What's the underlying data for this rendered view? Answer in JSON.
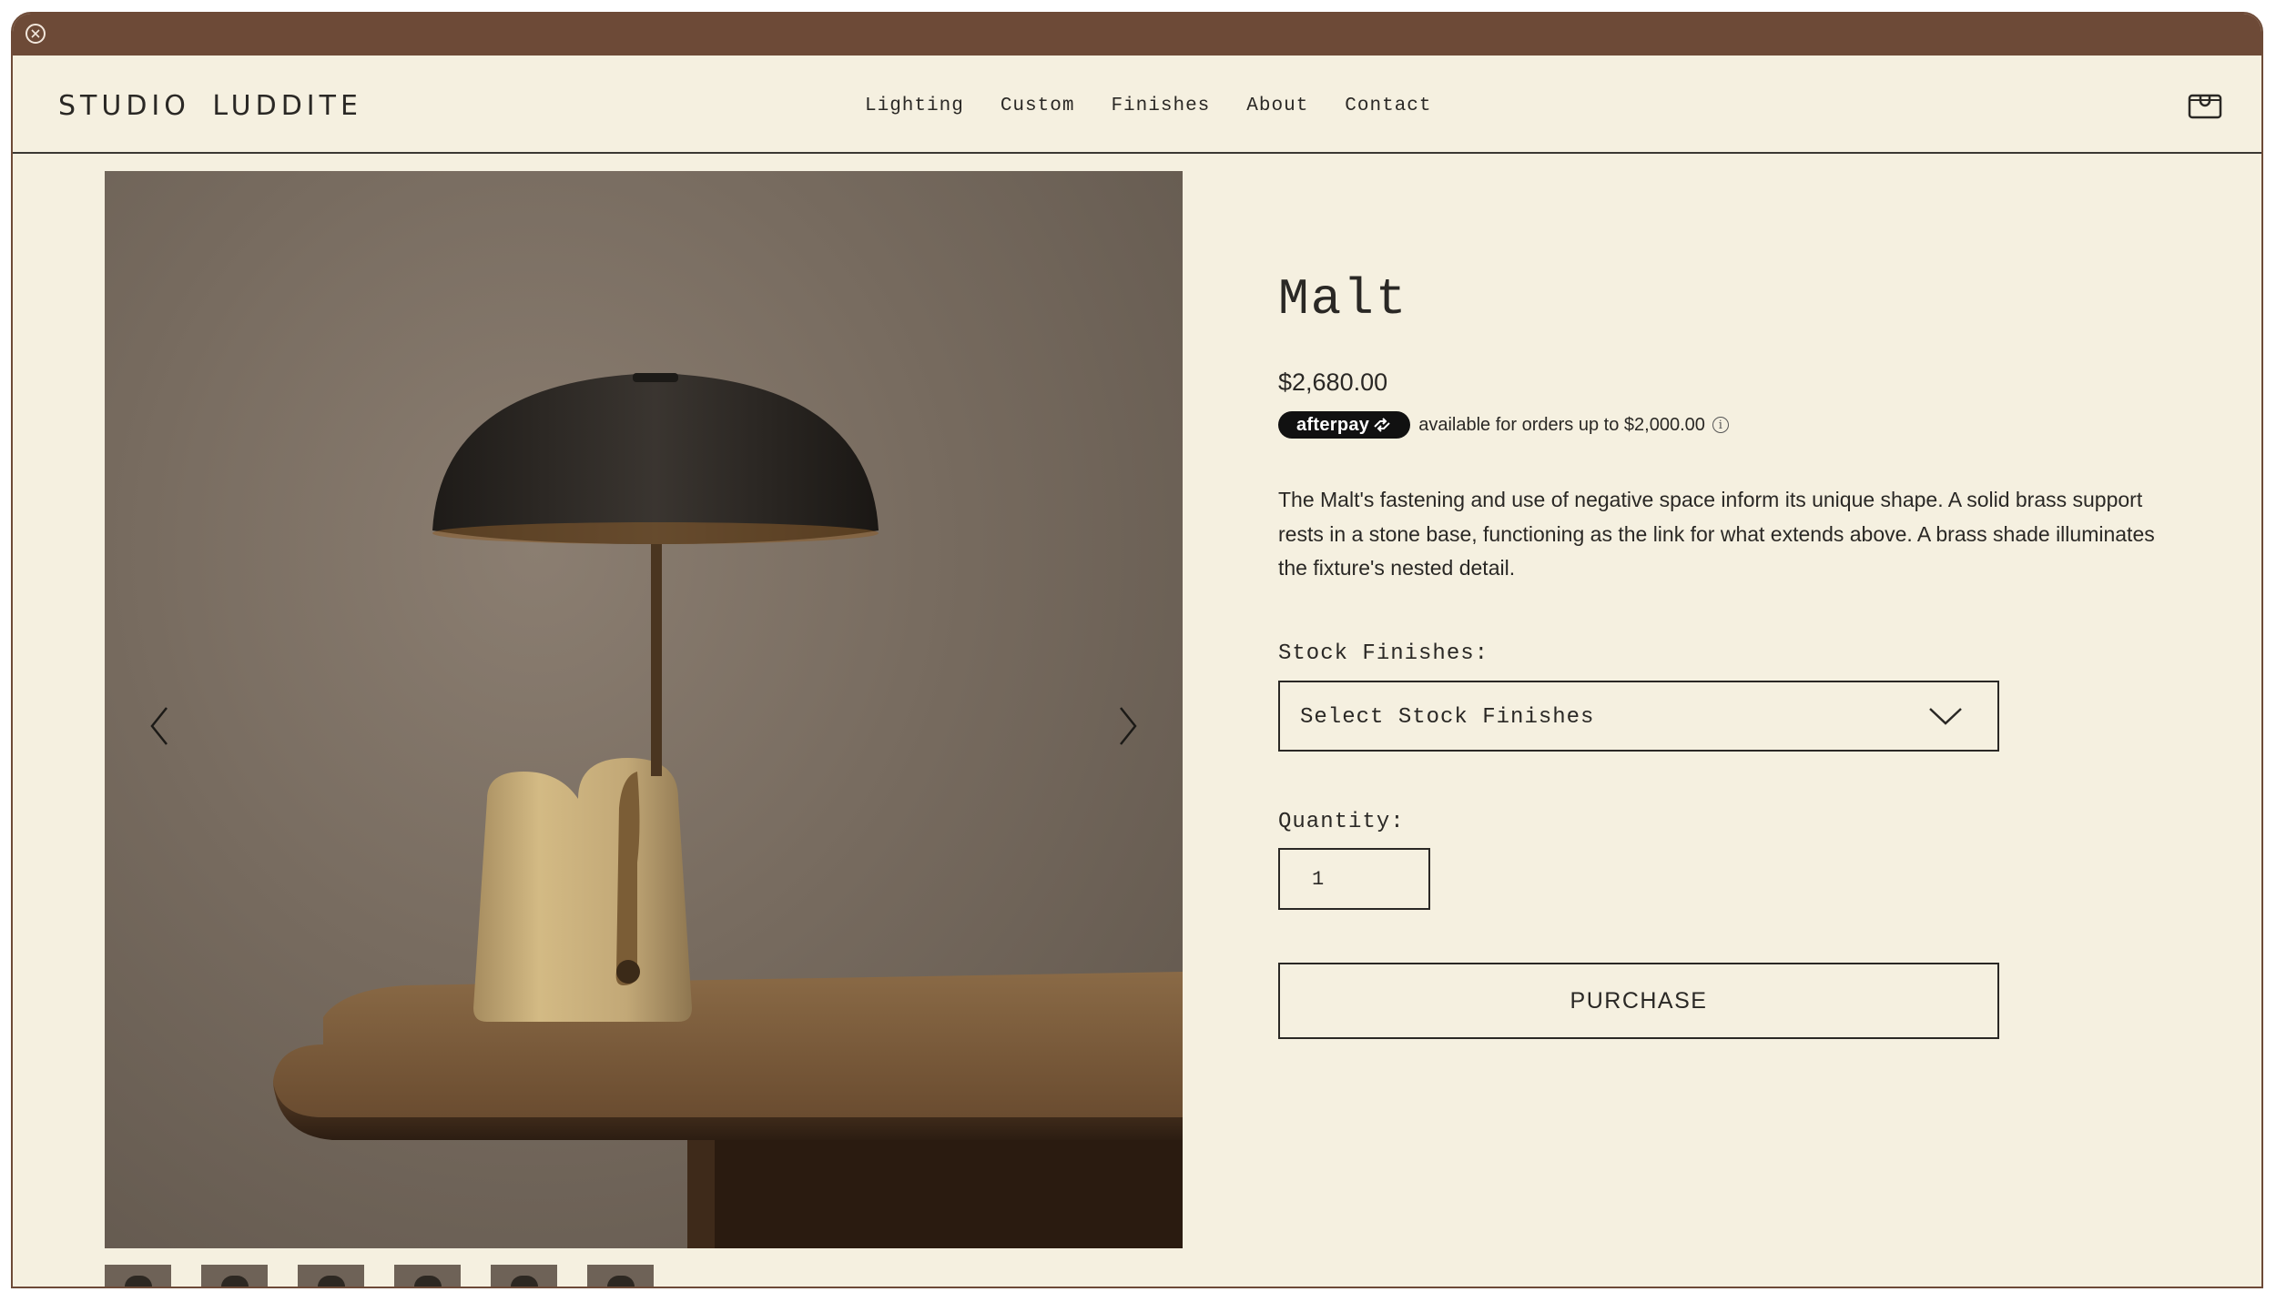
{
  "brand": {
    "name": "STUDIO LUDDITE"
  },
  "nav": {
    "items": [
      "Lighting",
      "Custom",
      "Finishes",
      "About",
      "Contact"
    ]
  },
  "icons": {
    "close": "close-icon",
    "cart": "cart-icon",
    "prev": "chevron-left-icon",
    "next": "chevron-right-icon",
    "dropdown": "chevron-down-icon",
    "info": "info-icon"
  },
  "colors": {
    "titlebar": "#6d4a37",
    "background": "#f5f0e0",
    "text": "#2a2825",
    "afterpay": "#111111"
  },
  "product": {
    "name": "Malt",
    "price": "$2,680.00",
    "afterpay_badge": "afterpay",
    "afterpay_text": "available for orders up to $2,000.00",
    "description": "The Malt's fastening and use of negative space inform its unique shape. A solid brass support rests in a stone base, functioning as the link for what extends above. A brass shade illuminates the fixture's nested detail.",
    "finishes_label": "Stock Finishes:",
    "finishes_placeholder": "Select Stock Finishes",
    "quantity_label": "Quantity:",
    "quantity_value": "1",
    "purchase_label": "PURCHASE"
  }
}
